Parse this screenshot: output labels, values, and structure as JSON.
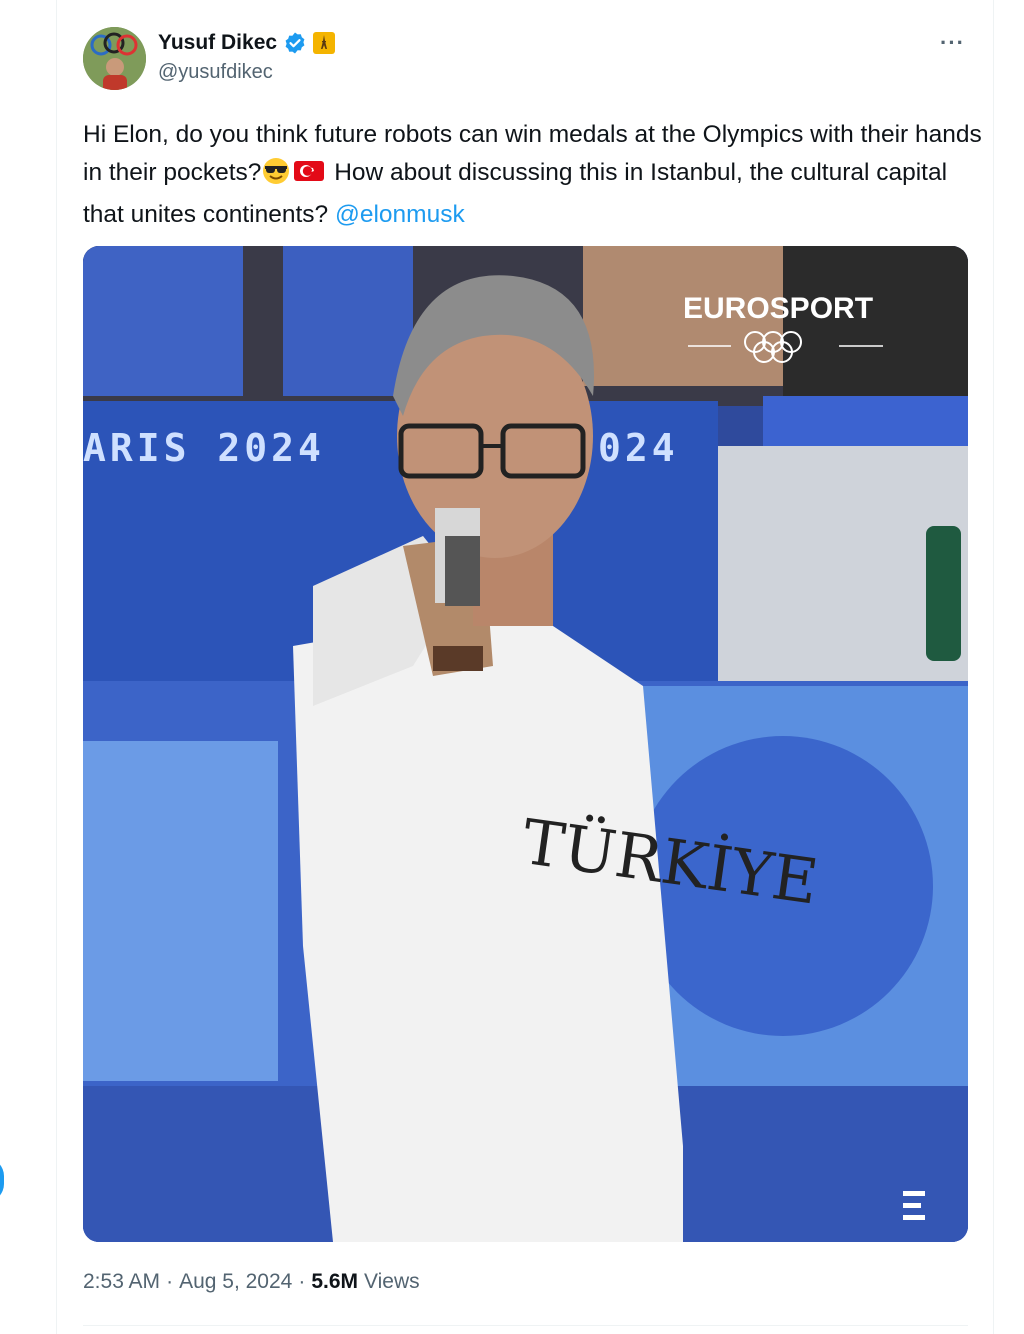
{
  "author": {
    "name": "Yusuf Dikec",
    "handle": "@yusufdikec",
    "verified": true,
    "badge_icon": "eiffel-tower-icon"
  },
  "tweet": {
    "text_part1": "Hi Elon, do you think future robots can win medals at the Olympics with their hands in their pockets?",
    "emoji1": "smiling-face-with-sunglasses",
    "emoji2": "turkey-flag",
    "text_part2": " How about discussing this in Istanbul, the cultural capital that unites continents? ",
    "mention": "@elonmusk"
  },
  "media": {
    "broadcaster": "EUROSPORT",
    "banner_left": "ARIS 2024",
    "banner_right": "024",
    "shirt_text": "TÜRKİYE"
  },
  "meta": {
    "time": "2:53 AM",
    "date": "Aug 5, 2024",
    "views_count": "5.6M",
    "views_label": "Views"
  },
  "colors": {
    "accent": "#1d9bf0",
    "text": "#0f1419",
    "secondary": "#536471"
  }
}
